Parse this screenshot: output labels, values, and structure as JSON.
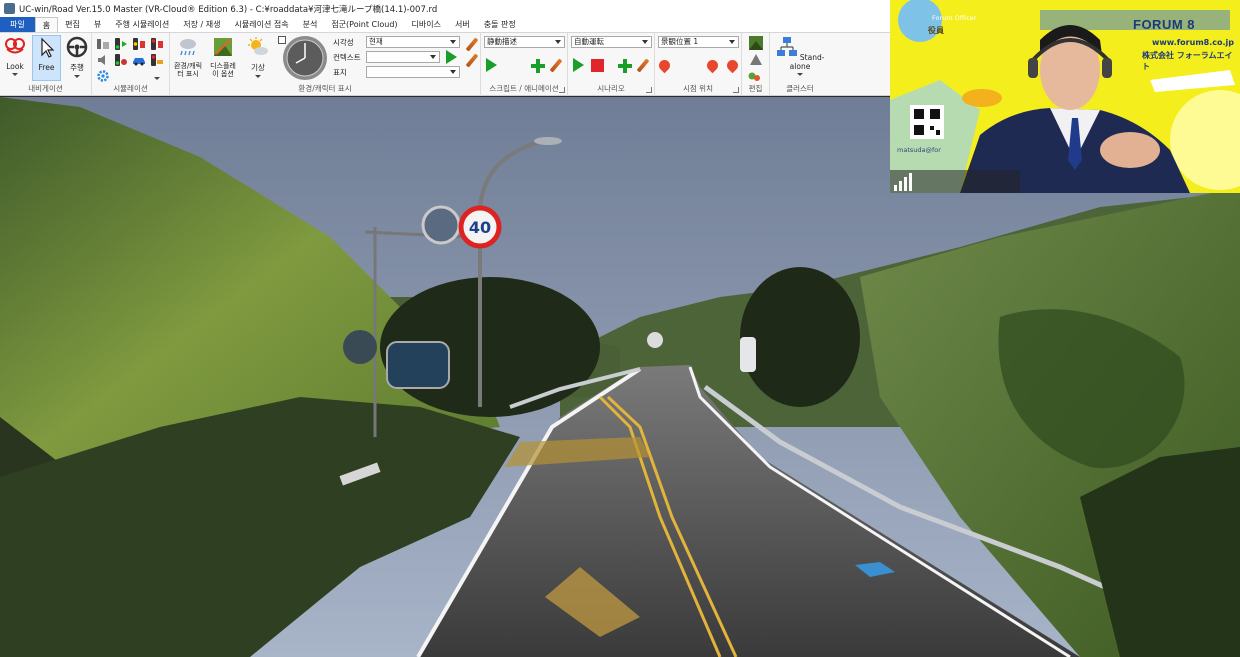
{
  "window": {
    "title": "UC-win/Road Ver.15.0 Master (VR-Cloud® Edition 6.3) - C:¥roaddata¥河津七滝ループ橋(14.1)-007.rd"
  },
  "tabs": [
    {
      "label": "파일",
      "type": "file"
    },
    {
      "label": "홈",
      "type": "active"
    },
    {
      "label": "편집"
    },
    {
      "label": "뷰"
    },
    {
      "label": "주행 시뮬레이션"
    },
    {
      "label": "저장 / 재생"
    },
    {
      "label": "시뮬레이션 접속"
    },
    {
      "label": "분석"
    },
    {
      "label": "점군(Point Cloud)"
    },
    {
      "label": "디바이스"
    },
    {
      "label": "서버"
    },
    {
      "label": "충돌 판정"
    }
  ],
  "ribbon": {
    "navigation": {
      "label": "내비게이션",
      "look": "Look",
      "free": "Free",
      "drive": "주행"
    },
    "simulation": {
      "label": "시뮬레이션"
    },
    "environment": {
      "label": "환경/캐릭터 표시",
      "weather_label": "환경/캐릭터 표시",
      "display_label": "디스플레이 옵션",
      "sky_label": "기상",
      "time_label": "시각성",
      "context_label": "컨텍스트",
      "display_row_label": "표지",
      "time_value": "현재",
      "context_value": "",
      "display_value": ""
    },
    "script": {
      "label": "스크립트 / 애니메이션",
      "value": "静動描述"
    },
    "scenario": {
      "label": "시나리오",
      "value": "自動運転"
    },
    "viewpoint": {
      "label": "시점 위치",
      "value": "景観位置 1"
    },
    "edit": {
      "label": "편집"
    },
    "cluster": {
      "label": "클러스터",
      "standalone": "Stand-alone"
    }
  },
  "webcam": {
    "brand": "FORUM 8",
    "url": "www.forum8.co.jp",
    "corp": "株式会社 フォーラムエイト",
    "officer": "Forum Officer",
    "title_text": "役員",
    "mail": "matsuda@for"
  },
  "scene": {
    "speed_sign": "40"
  }
}
